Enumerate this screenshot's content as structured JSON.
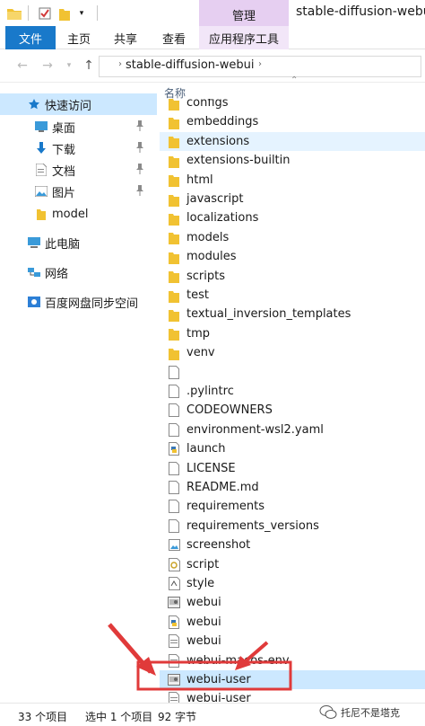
{
  "window": {
    "title": "stable-diffusion-webui",
    "manage_tab": "管理"
  },
  "ribbon": {
    "tabs": [
      "文件",
      "主页",
      "共享",
      "查看",
      "应用程序工具"
    ]
  },
  "address": {
    "path": "stable-diffusion-webui"
  },
  "nav": {
    "items": [
      "快速访问",
      "桌面",
      "下载",
      "文档",
      "图片",
      "model",
      "此电脑",
      "网络",
      "百度网盘同步空间"
    ]
  },
  "list": {
    "column_name": "名称",
    "items": [
      {
        "name": "configs",
        "type": "folder"
      },
      {
        "name": "embeddings",
        "type": "folder"
      },
      {
        "name": "extensions",
        "type": "folder"
      },
      {
        "name": "extensions-builtin",
        "type": "folder"
      },
      {
        "name": "html",
        "type": "folder"
      },
      {
        "name": "javascript",
        "type": "folder"
      },
      {
        "name": "localizations",
        "type": "folder"
      },
      {
        "name": "models",
        "type": "folder"
      },
      {
        "name": "modules",
        "type": "folder"
      },
      {
        "name": "scripts",
        "type": "folder"
      },
      {
        "name": "test",
        "type": "folder"
      },
      {
        "name": "textual_inversion_templates",
        "type": "folder"
      },
      {
        "name": "tmp",
        "type": "folder"
      },
      {
        "name": "venv",
        "type": "folder"
      },
      {
        "name": "",
        "type": "doc"
      },
      {
        "name": ".pylintrc",
        "type": "doc"
      },
      {
        "name": "CODEOWNERS",
        "type": "doc"
      },
      {
        "name": "environment-wsl2.yaml",
        "type": "doc"
      },
      {
        "name": "launch",
        "type": "python"
      },
      {
        "name": "LICENSE",
        "type": "doc"
      },
      {
        "name": "README.md",
        "type": "doc"
      },
      {
        "name": "requirements",
        "type": "doc"
      },
      {
        "name": "requirements_versions",
        "type": "doc"
      },
      {
        "name": "screenshot",
        "type": "image"
      },
      {
        "name": "script",
        "type": "script"
      },
      {
        "name": "style",
        "type": "css"
      },
      {
        "name": "webui",
        "type": "batch"
      },
      {
        "name": "webui",
        "type": "python"
      },
      {
        "name": "webui",
        "type": "shell"
      },
      {
        "name": "webui-macos-env",
        "type": "shell"
      },
      {
        "name": "webui-user",
        "type": "batch"
      },
      {
        "name": "webui-user",
        "type": "shell"
      }
    ]
  },
  "status": {
    "count": "33 个项目",
    "selected": "选中 1 个项目",
    "size": "92 字节"
  },
  "watermark": "托尼不是塔克",
  "colors": {
    "accent": "#1979ca",
    "selection": "#cce8ff",
    "manage": "#e6cff1",
    "folder": "#f1c232",
    "annotation": "#e03a3a"
  }
}
